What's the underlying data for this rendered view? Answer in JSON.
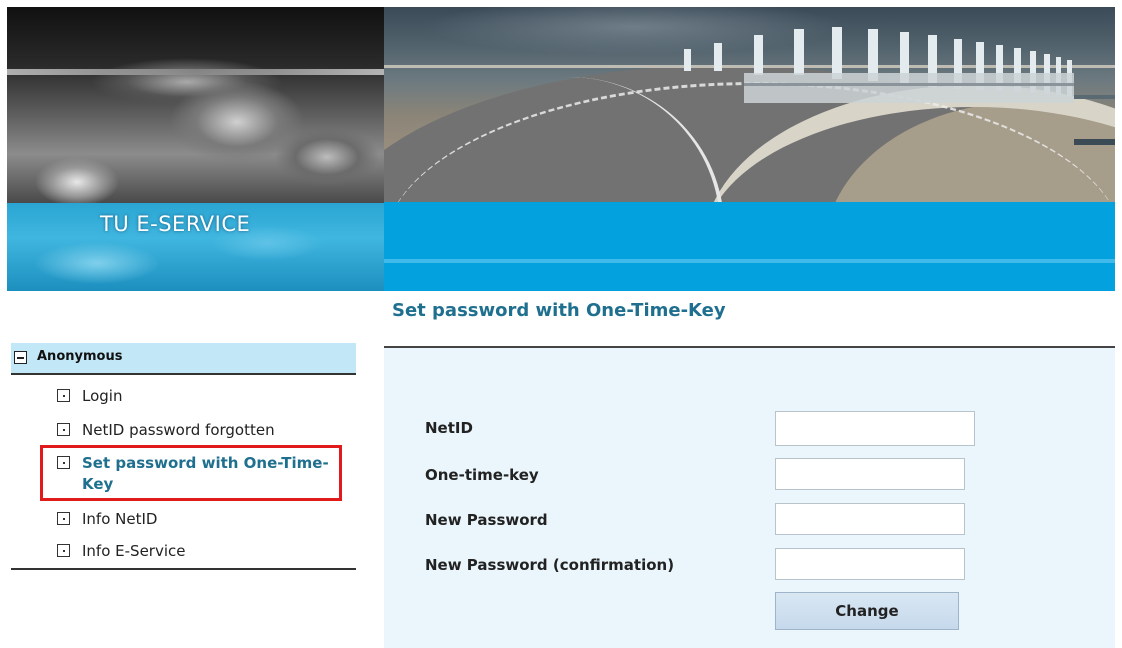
{
  "header": {
    "logo_text": "TU E-SERVICE"
  },
  "main": {
    "title": "Set password with One-Time-Key",
    "form": {
      "fields": [
        {
          "label": "NetID",
          "value": ""
        },
        {
          "label": "One-time-key",
          "value": ""
        },
        {
          "label": "New Password",
          "value": ""
        },
        {
          "label": "New Password (confirmation)",
          "value": ""
        }
      ],
      "submit_label": "Change"
    }
  },
  "sidebar": {
    "section_label": "Anonymous",
    "items": [
      {
        "label": "Login"
      },
      {
        "label": "NetID password forgotten"
      },
      {
        "label": "Set password with One-Time-Key",
        "active": true
      },
      {
        "label": "Info NetID"
      },
      {
        "label": "Info E-Service"
      }
    ]
  },
  "colors": {
    "accent_blue": "#03a2df",
    "title_text": "#1f6f8f",
    "form_bg": "#eaf6fb",
    "nav_header_bg": "#c2e7f6",
    "highlight_red": "#e11b1b"
  },
  "icons": {
    "section_toggle": "collapse-minus-icon",
    "nav_bullet": "square-bullet-icon"
  }
}
